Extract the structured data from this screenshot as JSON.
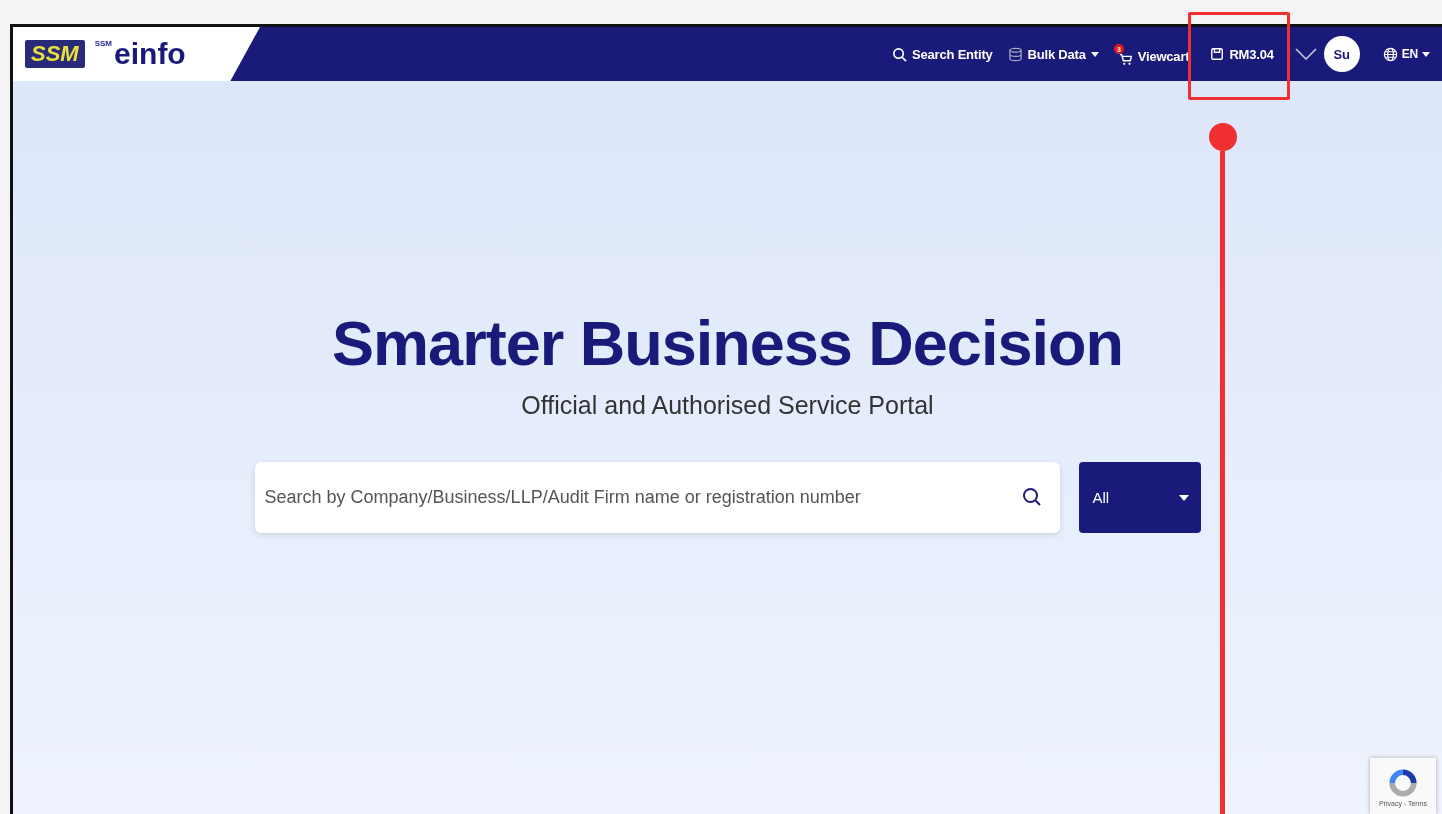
{
  "logo": {
    "mark": "SSM",
    "product_prefix": "SSM",
    "product": "einfo"
  },
  "nav": [
    {
      "kind": "search",
      "label": "Search Entity"
    },
    {
      "kind": "dropdown",
      "label": "Bulk Data"
    },
    {
      "kind": "cart",
      "label": "Viewcart",
      "badge": "3"
    },
    {
      "kind": "wallet",
      "label": "RM3.04"
    }
  ],
  "user": {
    "initials": "Su"
  },
  "language": {
    "label": "EN"
  },
  "hero": {
    "title": "Smarter Business Decision",
    "subtitle": "Official and Authorised Service Portal"
  },
  "search": {
    "placeholder": "Search by Company/Business/LLP/Audit Firm name or registration number"
  },
  "filter": {
    "value": "All"
  },
  "recaptcha": {
    "links": "Privacy - Terms"
  }
}
